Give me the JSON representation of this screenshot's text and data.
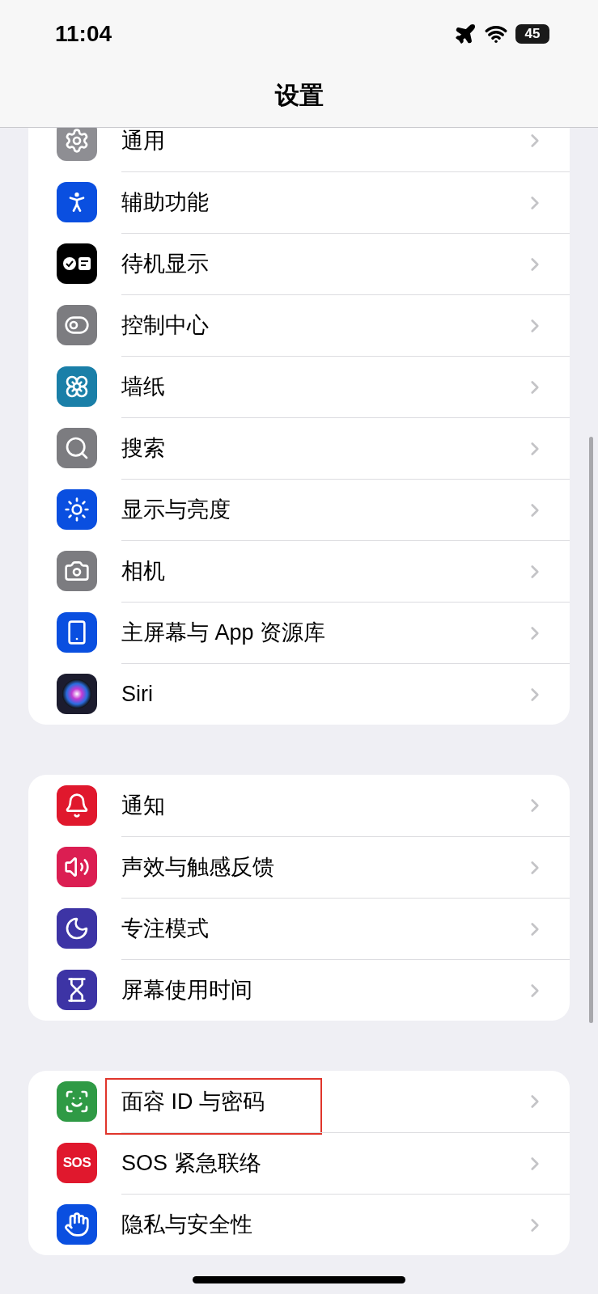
{
  "status_bar": {
    "time": "11:04",
    "battery": "45"
  },
  "title": "设置",
  "groups": [
    {
      "items": [
        {
          "label": "通用",
          "color": "#8e8e93"
        },
        {
          "label": "辅助功能",
          "color": "#0a4fe0"
        },
        {
          "label": "待机显示",
          "color": "#000000"
        },
        {
          "label": "控制中心",
          "color": "#7c7c80"
        },
        {
          "label": "墙纸",
          "color": "#1a7fa8"
        },
        {
          "label": "搜索",
          "color": "#7c7c80"
        },
        {
          "label": "显示与亮度",
          "color": "#0a4fe0"
        },
        {
          "label": "相机",
          "color": "#7c7c80"
        },
        {
          "label": "主屏幕与 App 资源库",
          "color": "#0a4fe0"
        },
        {
          "label": "Siri",
          "color": "#1c1c2e"
        }
      ]
    },
    {
      "items": [
        {
          "label": "通知",
          "color": "#e0182d"
        },
        {
          "label": "声效与触感反馈",
          "color": "#db1e52"
        },
        {
          "label": "专注模式",
          "color": "#3d34a5"
        },
        {
          "label": "屏幕使用时间",
          "color": "#3d34a5"
        }
      ]
    },
    {
      "items": [
        {
          "label": "面容 ID 与密码",
          "color": "#2f9a45",
          "highlighted": true
        },
        {
          "label": "SOS 紧急联络",
          "color": "#e0182d",
          "badge": "SOS",
          "highlighted": false
        },
        {
          "label": "隐私与安全性",
          "color": "#0a4fe0",
          "highlighted": false
        }
      ]
    }
  ]
}
